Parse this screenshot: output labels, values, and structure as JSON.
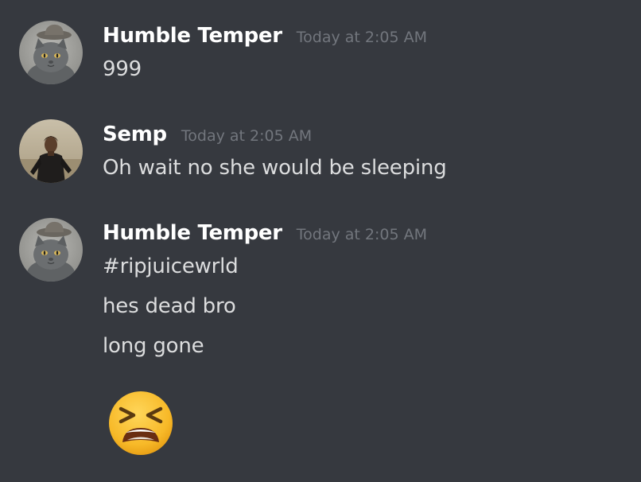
{
  "messages": [
    {
      "username": "Humble Temper",
      "timestamp": "Today at 2:05 AM",
      "avatar": "cat-avatar",
      "lines": [
        "999"
      ]
    },
    {
      "username": "Semp",
      "timestamp": "Today at 2:05 AM",
      "avatar": "person-avatar",
      "lines": [
        "Oh wait no she would be sleeping"
      ]
    },
    {
      "username": "Humble Temper",
      "timestamp": "Today at 2:05 AM",
      "avatar": "cat-avatar",
      "lines": [
        "#ripjuicewrld",
        "hes dead bro",
        "long gone"
      ],
      "emoji": "tired-face-emoji"
    }
  ],
  "colors": {
    "background": "#36393f",
    "username": "#ffffff",
    "timestamp": "#72767d",
    "message_text": "#dcddde",
    "emoji_face": "#f7b928"
  }
}
